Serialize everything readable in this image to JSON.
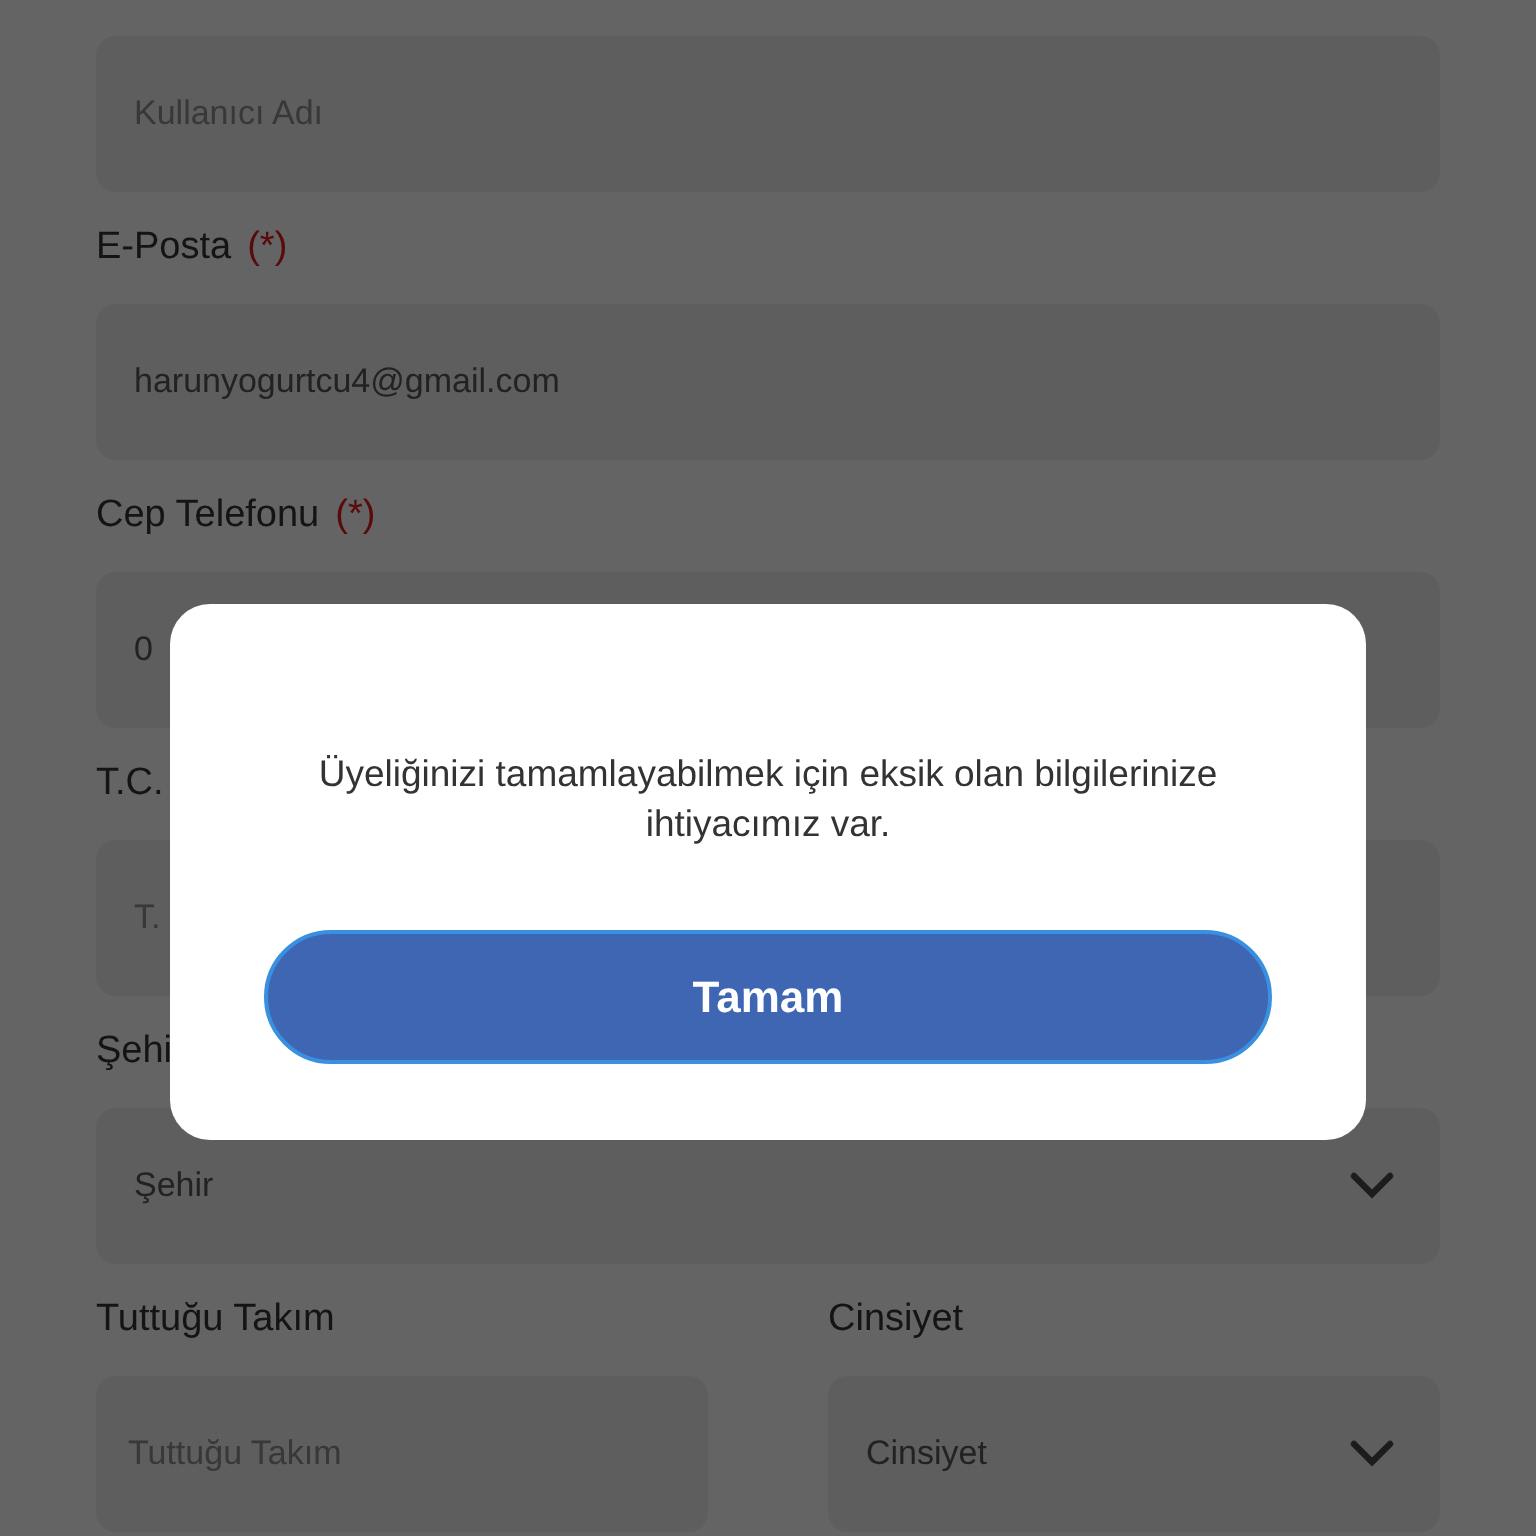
{
  "form": {
    "rows": [
      [
        {
          "kind": "text",
          "placeholder": "Kullanıcı Adı"
        }
      ],
      [
        {
          "kind": "text",
          "label": "E-Posta",
          "required_mark": "(*)",
          "value": "harunyogurtcu4@gmail.com"
        }
      ],
      [
        {
          "kind": "text",
          "label": "Cep Telefonu",
          "required_mark": "(*)",
          "value": "0"
        }
      ],
      [
        {
          "kind": "text",
          "label": "T.C.",
          "placeholder": "T."
        }
      ],
      [
        {
          "kind": "select",
          "label": "Şehi",
          "value": "Şehir"
        }
      ],
      [
        {
          "kind": "text",
          "label": "Tuttuğu Takım",
          "placeholder": "Tuttuğu Takım"
        },
        {
          "kind": "select",
          "label": "Cinsiyet",
          "value": "Cinsiyet"
        }
      ]
    ]
  },
  "dialog": {
    "message": "Üyeliğinizi tamamlayabilmek için eksik olan bilgilerinize ihtiyacımız var.",
    "button": "Tamam"
  }
}
